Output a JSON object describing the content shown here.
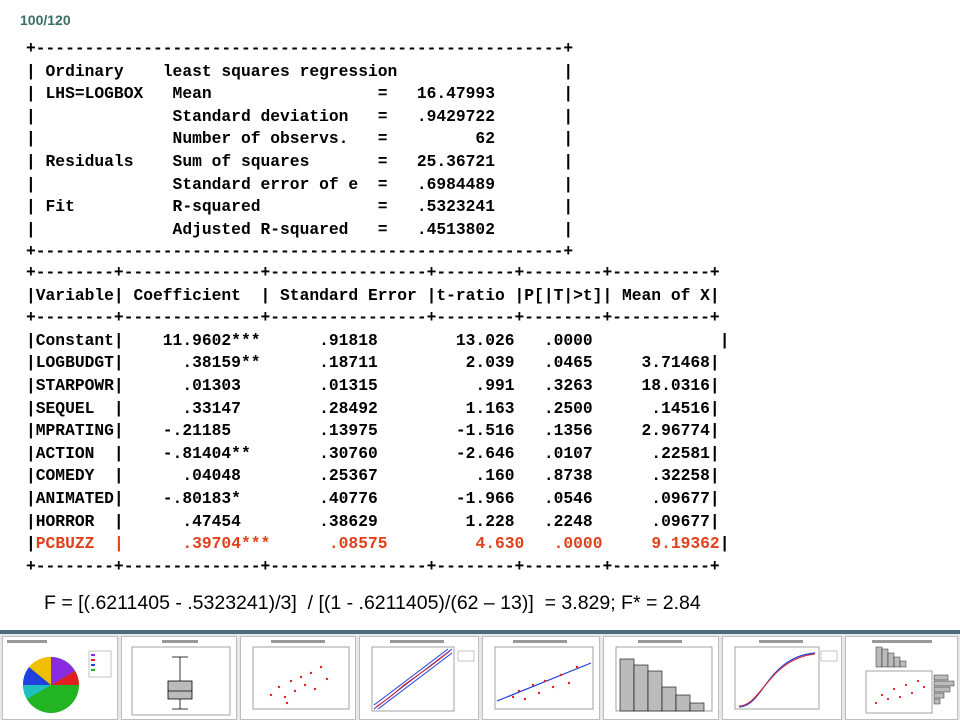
{
  "slide_number": "100/120",
  "summary": {
    "border": "+------------------------------------------------------+",
    "lines": [
      "| Ordinary    least squares regression                 |",
      "| LHS=LOGBOX   Mean                 =   16.47993       |",
      "|              Standard deviation   =   .9429722       |",
      "|              Number of observs.   =         62       |",
      "| Residuals    Sum of squares       =   25.36721       |",
      "|              Standard error of e  =   .6984489       |",
      "| Fit          R-squared            =   .5323241       |",
      "|              Adjusted R-squared   =   .4513802       |"
    ]
  },
  "coefficients": {
    "border": "+--------+--------------+----------------+--------+--------+----------+",
    "header": "|Variable| Coefficient  | Standard Error |t-ratio |P[|T|>t]| Mean of X|",
    "rows": [
      "|Constant|    11.9602***      .91818        13.026   .0000             |",
      "|LOGBUDGT|      .38159**      .18711         2.039   .0465     3.71468|",
      "|STARPOWR|      .01303        .01315          .991   .3263     18.0316|",
      "|SEQUEL  |      .33147        .28492         1.163   .2500      .14516|",
      "|MPRATING|    -.21185         .13975        -1.516   .1356     2.96774|",
      "|ACTION  |    -.81404**       .30760        -2.646   .0107      .22581|",
      "|COMEDY  |      .04048        .25367          .160   .8738      .32258|",
      "|ANIMATED|    -.80183*        .40776        -1.966   .0546      .09677|",
      "|HORROR  |      .47454        .38629         1.228   .2248      .09677|"
    ],
    "highlight_row_left": "|",
    "highlight_row_text": "PCBUZZ  |      .39704***      .08575         4.630   .0000     9.19362",
    "highlight_row_right": "|"
  },
  "f_test": "F = [(.6211405 - .5323241)/3]  / [(1 - .6211405)/(62 – 13)]  = 3.829; F* = 2.84",
  "colors": {
    "highlight": "#e0401c",
    "slide_number": "#3c6e64",
    "bottom_bar": "#4a6c7c"
  }
}
